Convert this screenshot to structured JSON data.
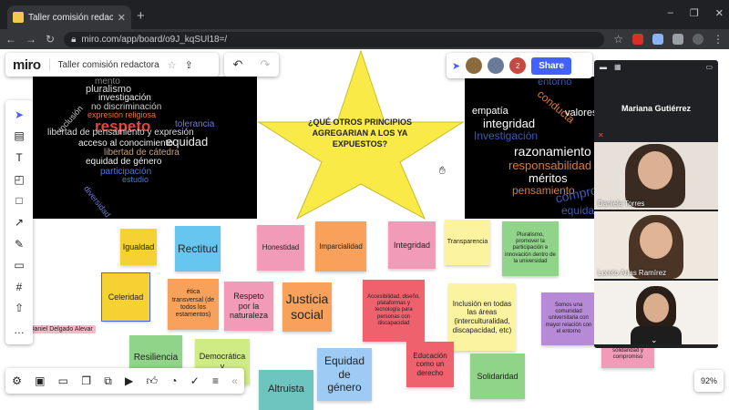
{
  "browser": {
    "tab_title": "Taller comisión redactora: Online",
    "url": "miro.com/app/board/o9J_kqSUl18=/"
  },
  "miro": {
    "logo": "miro",
    "board_title": "Taller comisión redactora",
    "share_label": "Share",
    "zoom": "92%",
    "collaborator_count": "2",
    "cursor_label": "s Daniel Delgado Alevar"
  },
  "star_text": "¿QUÉ OTROS PRINCIPIOS AGREGARIAN A LOS YA EXPUESTOS?",
  "left_cloud_words": [
    "mento",
    "pluralismo",
    "investigación",
    "no discriminación",
    "expresión religiosa",
    "respeto",
    "tolerancia",
    "equidad",
    "inclusión",
    "libertad de pensamiento y expresión",
    "acceso al conocimiento",
    "libertad de cátedra",
    "equidad de género",
    "participación",
    "estudio",
    "diversidad"
  ],
  "right_cloud_words": [
    "entorno",
    "conducta",
    "empatía",
    "valores",
    "integridad",
    "Investigación",
    "razonamiento",
    "responsabilidad",
    "méritos",
    "pensamiento",
    "compromiso",
    "equidad"
  ],
  "stickies": [
    {
      "text": "Igualdad",
      "color": "#f5d232"
    },
    {
      "text": "Rectitud",
      "color": "#67c6f0"
    },
    {
      "text": "Honestidad",
      "color": "#f29bb8"
    },
    {
      "text": "Imparcialidad",
      "color": "#f7a15a"
    },
    {
      "text": "Integridad",
      "color": "#f29bb8"
    },
    {
      "text": "Transparencia",
      "color": "#fbf3a0"
    },
    {
      "text": "Pluralismo, promover la participación e innovación dentro de la universidad",
      "color": "#8fd488"
    },
    {
      "text": "Celeridad",
      "color": "#f5d232"
    },
    {
      "text": "ética transversal (de todos los estamentos)",
      "color": "#f7a15a"
    },
    {
      "text": "Respeto por la naturaleza",
      "color": "#f29bb8"
    },
    {
      "text": "Justicia social",
      "color": "#f7a15a"
    },
    {
      "text": "Accesibilidad, diseño, plataformas y tecnología para personas con discapacidad",
      "color": "#f0616e"
    },
    {
      "text": "Inclusión en todas las áreas (interculturalidad, discapacidad, etc)",
      "color": "#fbf3a0"
    },
    {
      "text": "Somos una comunidad universitaria con mayor relación con el entorno",
      "color": "#b78ad8"
    },
    {
      "text": "Resiliencia",
      "color": "#8fd488"
    },
    {
      "text": "Democrática y",
      "color": "#cfeb84"
    },
    {
      "text": "Altruista",
      "color": "#6ec5c0"
    },
    {
      "text": "Equidad de género",
      "color": "#9ecbf4"
    },
    {
      "text": "Educación como un derecho",
      "color": "#f0616e"
    },
    {
      "text": "Solidaridad",
      "color": "#8fd488"
    },
    {
      "text": "solidaridad y compromiso",
      "color": "#f29bb8"
    }
  ],
  "participants": [
    {
      "name": "Mariana Gutiérrez"
    },
    {
      "name": "Daniela Torres"
    },
    {
      "name": "Loreto Arias Ramírez"
    },
    {
      "name": ""
    }
  ]
}
